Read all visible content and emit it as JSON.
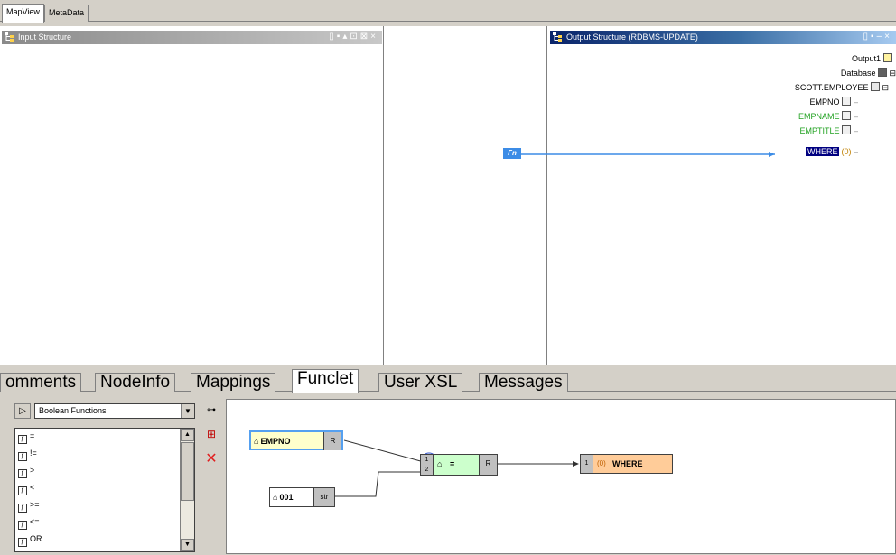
{
  "top_tabs": [
    {
      "label": "MapView",
      "active": true
    },
    {
      "label": "MetaData",
      "active": false
    }
  ],
  "input_pane": {
    "title": "Input Structure",
    "tools": [
      "doc-icon",
      "save-icon",
      "up-icon",
      "tree-icon",
      "expand-icon",
      "close-icon"
    ]
  },
  "output_pane": {
    "title": "Output Structure (RDBMS-UPDATE)",
    "tree": [
      {
        "label": "Output1",
        "color": "#000000"
      },
      {
        "label": "Database",
        "color": "#000000"
      },
      {
        "label": "SCOTT.EMPLOYEE",
        "color": "#000000"
      },
      {
        "label": "EMPNO",
        "color": "#000000"
      },
      {
        "label": "EMPNAME",
        "color": "#22a222"
      },
      {
        "label": "EMPTITLE",
        "color": "#22a222"
      },
      {
        "label": "WHERE",
        "color": "#ffffff",
        "selected": true,
        "suffix": "(0)"
      }
    ]
  },
  "mapping": {
    "fn_badge": "Fn"
  },
  "bottom_tabs": [
    {
      "label": "omments",
      "active": false
    },
    {
      "label": "NodeInfo",
      "active": false
    },
    {
      "label": "Mappings",
      "active": false
    },
    {
      "label": "Funclet",
      "active": true
    },
    {
      "label": "User XSL",
      "active": false
    },
    {
      "label": "Messages",
      "active": false
    }
  ],
  "function_panel": {
    "category": "Boolean Functions",
    "functions": [
      "=",
      "!=",
      ">",
      "<",
      ">=",
      "<=",
      "OR"
    ]
  },
  "funclet": {
    "nodes": {
      "empno": {
        "label": "EMPNO",
        "port": "R"
      },
      "literal": {
        "label": "001",
        "port": "str"
      },
      "equals": {
        "label": "=",
        "input1": "1",
        "input2": "2",
        "port": "R"
      },
      "where": {
        "label": "WHERE",
        "input": "1",
        "prefix": "(0)"
      }
    }
  },
  "colors": {
    "accent": "#0a246a",
    "selection": "#000080",
    "mapping_line": "#3c8ce6",
    "node_yellow": "#ffffcc",
    "node_green": "#ccffcc",
    "node_orange": "#ffcc99"
  }
}
